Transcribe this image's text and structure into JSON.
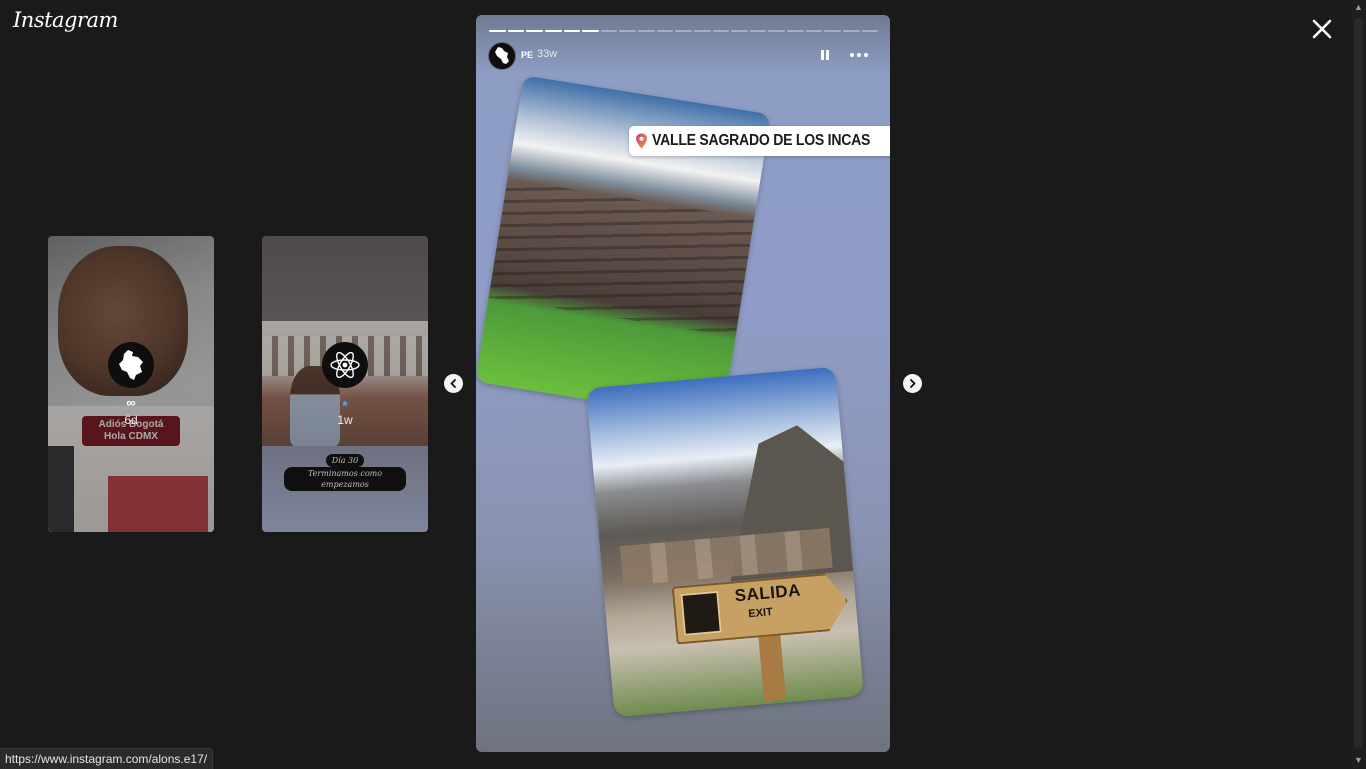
{
  "app": {
    "logo_text": "Instagram"
  },
  "previews": [
    {
      "name": "∞",
      "time": "6d",
      "sticker_line1": "Adiós Bogotá",
      "sticker_line2": "Hola CDMX"
    },
    {
      "name": "⭑",
      "time": "1w",
      "caption_line1": "Día 30",
      "caption_line2": "Terminamos como empezamos"
    }
  ],
  "story": {
    "user": "PE",
    "time": "33w",
    "location": "VALLE SAGRADO DE LOS INCAS",
    "sign_word": "SALIDA",
    "sign_word2": "EXIT",
    "progress": {
      "total": 21,
      "done": 6
    }
  },
  "status_bar": {
    "url": "https://www.instagram.com/alons.e17/"
  },
  "icons": {
    "close": "close-icon",
    "prev": "chevron-left-icon",
    "next": "chevron-right-icon",
    "pause": "pause-icon",
    "more": "more-icon",
    "location": "location-pin-icon"
  }
}
